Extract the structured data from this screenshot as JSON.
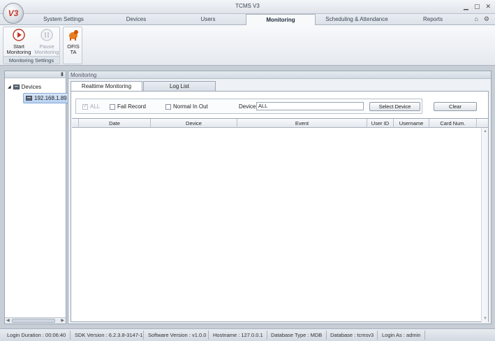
{
  "window": {
    "title": "TCMS V3",
    "orb_label": "V3"
  },
  "ribbon": {
    "tabs": [
      {
        "label": "System Settings"
      },
      {
        "label": "Devices"
      },
      {
        "label": "Users"
      },
      {
        "label": "Monitoring"
      },
      {
        "label": "Scheduling & Attendance"
      },
      {
        "label": "Reports"
      }
    ],
    "active_tab": "Monitoring",
    "groups": {
      "monitoring_settings": {
        "label": "Monitoring Settings",
        "start": {
          "line1": "Start",
          "line2": "Monitoring"
        },
        "pause": {
          "line1": "Pause",
          "line2": "Monitoring"
        }
      },
      "ofis": {
        "line1": "OFIS",
        "line2": "TA"
      }
    }
  },
  "left_panel": {
    "tree": {
      "root": "Devices",
      "expander": "◢",
      "children": [
        "192.168.1.89"
      ]
    }
  },
  "main": {
    "header": "Monitoring",
    "tabs": [
      {
        "label": "Realtime Monitoring"
      },
      {
        "label": "Log List"
      }
    ],
    "filters": {
      "all": {
        "label": "ALL"
      },
      "fail_record": {
        "label": "Fail Record"
      },
      "normal_in_out": {
        "label": "Normal In Out"
      },
      "device_label": "Device",
      "device_value": "ALL",
      "select_device": "Select Device",
      "clear": "Clear"
    },
    "grid": {
      "columns": [
        "Date",
        "Device",
        "Event",
        "User ID",
        "Username",
        "Card Num."
      ],
      "rows": []
    }
  },
  "status": {
    "login_duration": "Login Duration : 00:06:40",
    "sdk_version": "SDK Version : 6.2.3.8-3147-1",
    "software_version": "Software Version : v1.0.0",
    "hostname": "Hostname : 127.0.0.1",
    "database_type": "Database Type : MDB",
    "database": "Database : tcmsv3",
    "login_as": "Login As : admin"
  }
}
